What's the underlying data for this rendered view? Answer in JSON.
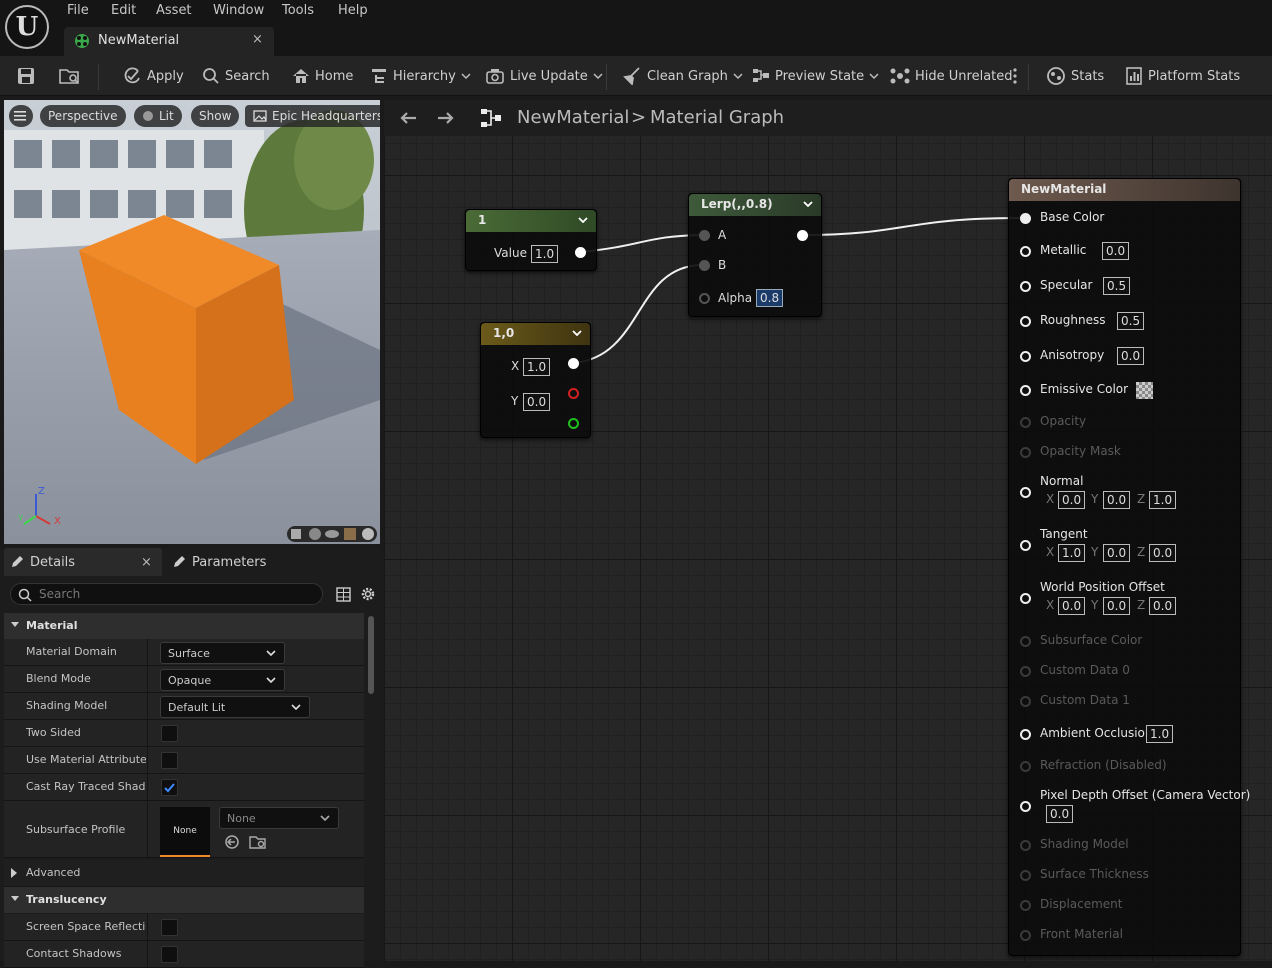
{
  "menu": [
    "File",
    "Edit",
    "Asset",
    "Window",
    "Tools",
    "Help"
  ],
  "tab": {
    "title": "NewMaterial",
    "close": "×"
  },
  "toolbar": {
    "apply": "Apply",
    "search": "Search",
    "home": "Home",
    "hierarchy": "Hierarchy",
    "live_update": "Live Update",
    "clean_graph": "Clean Graph",
    "preview_state": "Preview State",
    "hide_unrelated": "Hide Unrelated",
    "stats": "Stats",
    "platform_stats": "Platform Stats"
  },
  "viewport": {
    "perspective": "Perspective",
    "lit": "Lit",
    "show": "Show",
    "epic": "Epic Headquarters",
    "axis_z": "Z",
    "axis_x": "X",
    "axis_y": "Y"
  },
  "details": {
    "tab_details": "Details",
    "tab_close": "×",
    "tab_parameters": "Parameters",
    "search_placeholder": "Search",
    "cat_material": "Material",
    "rows": {
      "material_domain": {
        "label": "Material Domain",
        "value": "Surface"
      },
      "blend_mode": {
        "label": "Blend Mode",
        "value": "Opaque"
      },
      "shading_model": {
        "label": "Shading Model",
        "value": "Default Lit"
      },
      "two_sided": {
        "label": "Two Sided"
      },
      "use_material_attributes": {
        "label": "Use Material Attributes"
      },
      "cast_ray_traced": {
        "label": "Cast Ray Traced Shad..."
      },
      "subsurface_profile": {
        "label": "Subsurface Profile",
        "thumb": "None",
        "value": "None"
      }
    },
    "cat_advanced": "Advanced",
    "cat_translucency": "Translucency",
    "screen_space": "Screen Space Reflecti...",
    "contact_shadows": "Contact Shadows"
  },
  "graph_header": {
    "asset": "NewMaterial",
    "separator": ">",
    "graph": "Material Graph"
  },
  "nodes": {
    "constant": {
      "title": "1",
      "pin_label": "Value",
      "value": "1.0"
    },
    "constant2": {
      "title": "1,0",
      "x_label": "X",
      "x_value": "1.0",
      "y_label": "Y",
      "y_value": "0.0"
    },
    "lerp": {
      "title": "Lerp(,,0.8)",
      "a": "A",
      "b": "B",
      "alpha": "Alpha",
      "alpha_value": "0.8"
    },
    "result": {
      "title": "NewMaterial",
      "base_color": "Base Color",
      "metallic": "Metallic",
      "metallic_value": "0.0",
      "specular": "Specular",
      "specular_value": "0.5",
      "roughness": "Roughness",
      "roughness_value": "0.5",
      "anisotropy": "Anisotropy",
      "anisotropy_value": "0.0",
      "emissive": "Emissive Color",
      "opacity": "Opacity",
      "opacity_mask": "Opacity Mask",
      "normal": "Normal",
      "normal_x": "0.0",
      "normal_y": "0.0",
      "normal_z": "1.0",
      "tangent": "Tangent",
      "tangent_x": "1.0",
      "tangent_y": "0.0",
      "tangent_z": "0.0",
      "wpo": "World Position Offset",
      "wpo_x": "0.0",
      "wpo_y": "0.0",
      "wpo_z": "0.0",
      "subsurface": "Subsurface Color",
      "custom0": "Custom Data 0",
      "custom1": "Custom Data 1",
      "ao": "Ambient Occlusion",
      "ao_value": "1.0",
      "refraction": "Refraction (Disabled)",
      "pdo": "Pixel Depth Offset (Camera Vector)",
      "pdo_value": "0.0",
      "shading_model": "Shading Model",
      "surface_thickness": "Surface Thickness",
      "displacement": "Displacement",
      "front_material": "Front Material",
      "axis_x": "X",
      "axis_y": "Y",
      "axis_z": "Z"
    }
  },
  "colors": {
    "const_header": "#4a6b36",
    "lerp_header": "#3e5a3a",
    "const2_header": "#6b5a1a",
    "result_header": "#6e5a4e",
    "cube": "#f08a28"
  }
}
